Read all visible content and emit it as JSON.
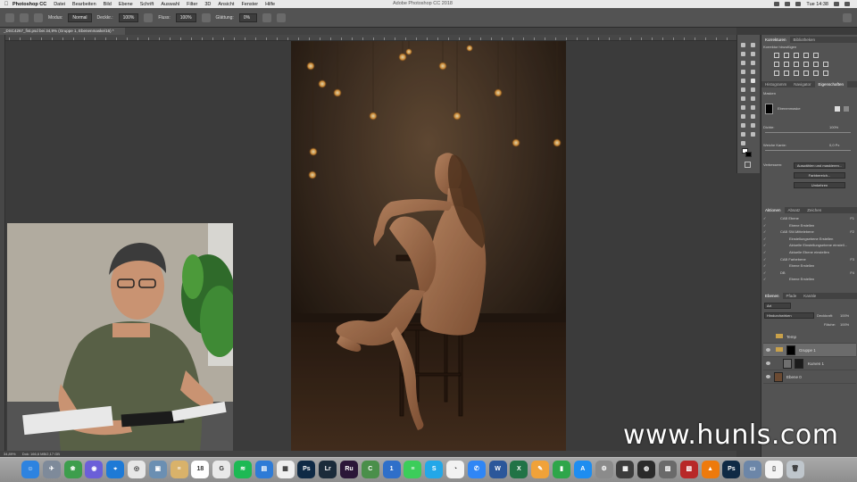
{
  "menubar": {
    "apple": "",
    "items": [
      "Photoshop CC",
      "Datei",
      "Bearbeiten",
      "Bild",
      "Ebene",
      "Schrift",
      "Auswahl",
      "Filter",
      "3D",
      "Ansicht",
      "Fenster",
      "Hilfe"
    ],
    "window_title": "Adobe Photoshop CC 2018",
    "time": "Tue 14:38"
  },
  "options_bar": {
    "mode_label": "Modus:",
    "mode_value": "Normal",
    "opacity_label": "Deckkr.:",
    "opacity_value": "100%",
    "flow_label": "Fluss:",
    "flow_value": "100%",
    "smoothing_label": "Glättung:",
    "smoothing_value": "0%"
  },
  "document_tab": {
    "title": "_DSC4267_fist.psd bei 34,9% (Gruppe 1, Ebenenmaske/16) *"
  },
  "statusbar": {
    "zoom": "34,89%",
    "doc": "Dok: 166,6 MB/2,17 GB"
  },
  "panels": {
    "corrections": {
      "tabs": [
        "Korrekturen",
        "Bibliotheken"
      ],
      "subtitle": "Korrektur hinzufügen"
    },
    "properties": {
      "tabs": [
        "Histogramm",
        "Navigator",
        "Eigenschaften"
      ],
      "section": "Masken",
      "mask_label": "Ebenenmaske",
      "density_label": "Dichte:",
      "density_value": "100%",
      "feather_label": "Weiche Kante:",
      "feather_value": "0,0 Px",
      "refine_label": "Verbessern:",
      "btn_select_mask": "Auswählen und maskieren...",
      "btn_color_range": "Farbbereich...",
      "btn_invert": "Umkehren"
    },
    "actions": {
      "tabs": [
        "Aktionen",
        "Absatz",
        "Zeichen"
      ],
      "rows": [
        "CAB Ebene",
        "Ebene Erstellen",
        "CAB SW-Mittelebene",
        "Einstellungsebene Erstellen",
        "Aktuelle Einstellungsebene einstell...",
        "Aktuelle Ebene einstellen",
        "CAB Farbebene",
        "Ebene Erstellen",
        "DB",
        "Ebene Erstellen"
      ],
      "shortcuts": [
        "F1",
        "F2",
        "F3",
        "F4"
      ]
    },
    "layers": {
      "tabs": [
        "Ebenen",
        "Pfade",
        "Kanäle"
      ],
      "filter_label": "Art",
      "blend_mode": "Hindurchwirken",
      "opacity_label": "Deckkraft:",
      "opacity_value": "100%",
      "fill_label": "Fläche:",
      "fill_value": "100%",
      "items": [
        {
          "name": "Temp"
        },
        {
          "name": "Gruppe 1"
        },
        {
          "name": "Kurven 1"
        },
        {
          "name": "Ebene 0"
        }
      ]
    }
  },
  "watermark": "www.hunls.com",
  "dock": {
    "items": [
      {
        "label": "Finder",
        "color": "#2d83e0",
        "glyph": "☺"
      },
      {
        "label": "Launchpad",
        "color": "#7e8a9a",
        "glyph": "✈"
      },
      {
        "label": "Mosaic",
        "color": "#3d9e4c",
        "glyph": "❀"
      },
      {
        "label": "Siri",
        "color": "#6b5fd8",
        "glyph": "◉"
      },
      {
        "label": "Safari",
        "color": "#1e7ad6",
        "glyph": "⌖"
      },
      {
        "label": "Chrome",
        "color": "#e7e7e7",
        "glyph": "◎"
      },
      {
        "label": "Preview",
        "color": "#6b8fb2",
        "glyph": "▣"
      },
      {
        "label": "Notes",
        "color": "#d9b26a",
        "glyph": "≡"
      },
      {
        "label": "Calendar",
        "color": "#ffffff",
        "glyph": "18"
      },
      {
        "label": "Google",
        "color": "#e9e9e9",
        "glyph": "G"
      },
      {
        "label": "Spotify",
        "color": "#1db954",
        "glyph": "≋"
      },
      {
        "label": "Keynote",
        "color": "#2e7bd6",
        "glyph": "▤"
      },
      {
        "label": "Stickies",
        "color": "#efefef",
        "glyph": "▦"
      },
      {
        "label": "Photoshop",
        "color": "#0f2a45",
        "glyph": "Ps"
      },
      {
        "label": "Lightroom",
        "color": "#1b2b3a",
        "glyph": "Lr"
      },
      {
        "label": "Rush",
        "color": "#2b1638",
        "glyph": "Ru"
      },
      {
        "label": "Corner",
        "color": "#4a8f4a",
        "glyph": "C"
      },
      {
        "label": "1Password",
        "color": "#2f6fc9",
        "glyph": "1"
      },
      {
        "label": "Messages",
        "color": "#3ccd5a",
        "glyph": "≡"
      },
      {
        "label": "Skype",
        "color": "#23a7e8",
        "glyph": "S"
      },
      {
        "label": "Reminders",
        "color": "#f2f2f2",
        "glyph": "◔"
      },
      {
        "label": "Messenger",
        "color": "#2f86f5",
        "glyph": "✆"
      },
      {
        "label": "Word",
        "color": "#2b579a",
        "glyph": "W"
      },
      {
        "label": "Excel",
        "color": "#217346",
        "glyph": "X"
      },
      {
        "label": "Pages",
        "color": "#f0a239",
        "glyph": "✎"
      },
      {
        "label": "Numbers",
        "color": "#2ea64a",
        "glyph": "▮"
      },
      {
        "label": "App Store",
        "color": "#1e8df0",
        "glyph": "A"
      },
      {
        "label": "System Preferences",
        "color": "#8b8b8b",
        "glyph": "⚙"
      },
      {
        "label": "Mosaic Pro",
        "color": "#3c3c3c",
        "glyph": "▩"
      },
      {
        "label": "Camera",
        "color": "#2a2a2a",
        "glyph": "◍"
      },
      {
        "label": "Photos",
        "color": "#6a6a6a",
        "glyph": "▨"
      },
      {
        "label": "Photo Booth",
        "color": "#b82828",
        "glyph": "▧"
      },
      {
        "label": "VLC",
        "color": "#ee7a0c",
        "glyph": "▲"
      },
      {
        "label": "Photoshop CC",
        "color": "#0f2a45",
        "glyph": "Ps"
      },
      {
        "label": "Image Capture",
        "color": "#6c86a8",
        "glyph": "▭"
      },
      {
        "label": "Document",
        "color": "#f4f4f4",
        "glyph": "▯"
      },
      {
        "label": "Trash",
        "color": "#bfc6cc",
        "glyph": "🗑"
      }
    ]
  }
}
